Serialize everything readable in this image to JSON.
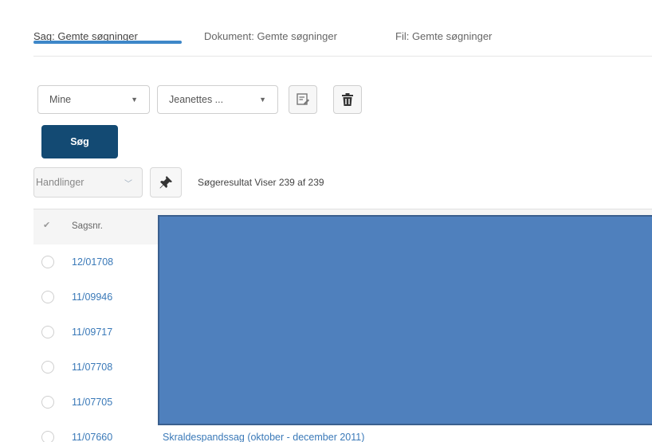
{
  "tabs": [
    {
      "label": "Sag: Gemte søgninger"
    },
    {
      "label": "Dokument: Gemte søgninger"
    },
    {
      "label": "Fil: Gemte søgninger"
    }
  ],
  "filters": {
    "owner_value": "Mine",
    "saved_search_value": "Jeanettes ..."
  },
  "search_button": "Søg",
  "actions_label": "Handlinger",
  "result_info": "Søgeresultat Viser 239 af 239",
  "table": {
    "header_col": "Sagsnr.",
    "rows": [
      {
        "caseno": "12/01708",
        "title": ""
      },
      {
        "caseno": "11/09946",
        "title": ""
      },
      {
        "caseno": "11/09717",
        "title": ""
      },
      {
        "caseno": "11/07708",
        "title": ""
      },
      {
        "caseno": "11/07705",
        "title": ""
      },
      {
        "caseno": "11/07660",
        "title": "Skraldespandssag (oktober - december 2011)"
      }
    ]
  },
  "colors": {
    "accent": "#3e87c8",
    "primary_button": "#134a73",
    "link": "#3a79b8",
    "redaction": "#4f80bd"
  }
}
